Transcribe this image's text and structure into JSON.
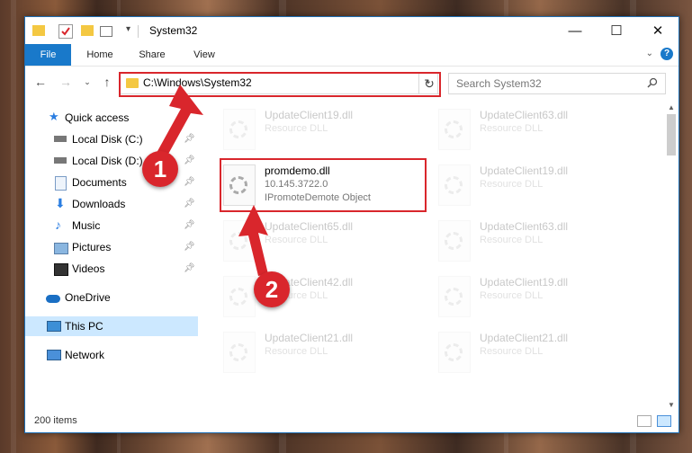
{
  "window": {
    "title": "System32"
  },
  "ribbon": {
    "tabs": [
      "File",
      "Home",
      "Share",
      "View"
    ],
    "help": "?"
  },
  "navbar": {
    "address": "C:\\Windows\\System32",
    "search_placeholder": "Search System32"
  },
  "sidebar": {
    "items": [
      {
        "label": "Quick access",
        "icon": "star-icon",
        "pinned": false
      },
      {
        "label": "Local Disk (C:)",
        "icon": "drive-icon",
        "pinned": true
      },
      {
        "label": "Local Disk (D:)",
        "icon": "drive-icon",
        "pinned": true
      },
      {
        "label": "Documents",
        "icon": "documents-icon",
        "pinned": true
      },
      {
        "label": "Downloads",
        "icon": "downloads-icon",
        "pinned": true
      },
      {
        "label": "Music",
        "icon": "music-icon",
        "pinned": true
      },
      {
        "label": "Pictures",
        "icon": "pictures-icon",
        "pinned": true
      },
      {
        "label": "Videos",
        "icon": "videos-icon",
        "pinned": true
      },
      {
        "label": "OneDrive",
        "icon": "cloud-icon",
        "pinned": false
      },
      {
        "label": "This PC",
        "icon": "computer-icon",
        "pinned": false,
        "selected": true
      },
      {
        "label": "Network",
        "icon": "network-icon",
        "pinned": false
      }
    ]
  },
  "files": {
    "highlighted": {
      "name": "promdemo.dll",
      "version": "10.145.3722.0",
      "description": "IPromoteDemote Object"
    },
    "left_column": [
      {
        "name": "UpdateClient19.dll",
        "type": "Resource DLL"
      },
      {
        "name": "UpdateClient65.dll",
        "type": "Resource DLL"
      },
      {
        "name": "UpdateClient42.dll",
        "type": "Resource DLL"
      },
      {
        "name": "UpdateClient21.dll",
        "type": "Resource DLL"
      }
    ],
    "right_column": [
      {
        "name": "UpdateClient63.dll",
        "type": "Resource DLL"
      },
      {
        "name": "UpdateClient19.dll",
        "type": "Resource DLL"
      },
      {
        "name": "UpdateClient63.dll",
        "type": "Resource DLL"
      },
      {
        "name": "UpdateClient19.dll",
        "type": "Resource DLL"
      },
      {
        "name": "UpdateClient21.dll",
        "type": "Resource DLL"
      }
    ]
  },
  "status": {
    "count": "200 items"
  },
  "annotations": {
    "step1": "1",
    "step2": "2"
  },
  "colors": {
    "accent": "#1979ca",
    "highlight_red": "#d9262c",
    "selection": "#cce8ff"
  }
}
